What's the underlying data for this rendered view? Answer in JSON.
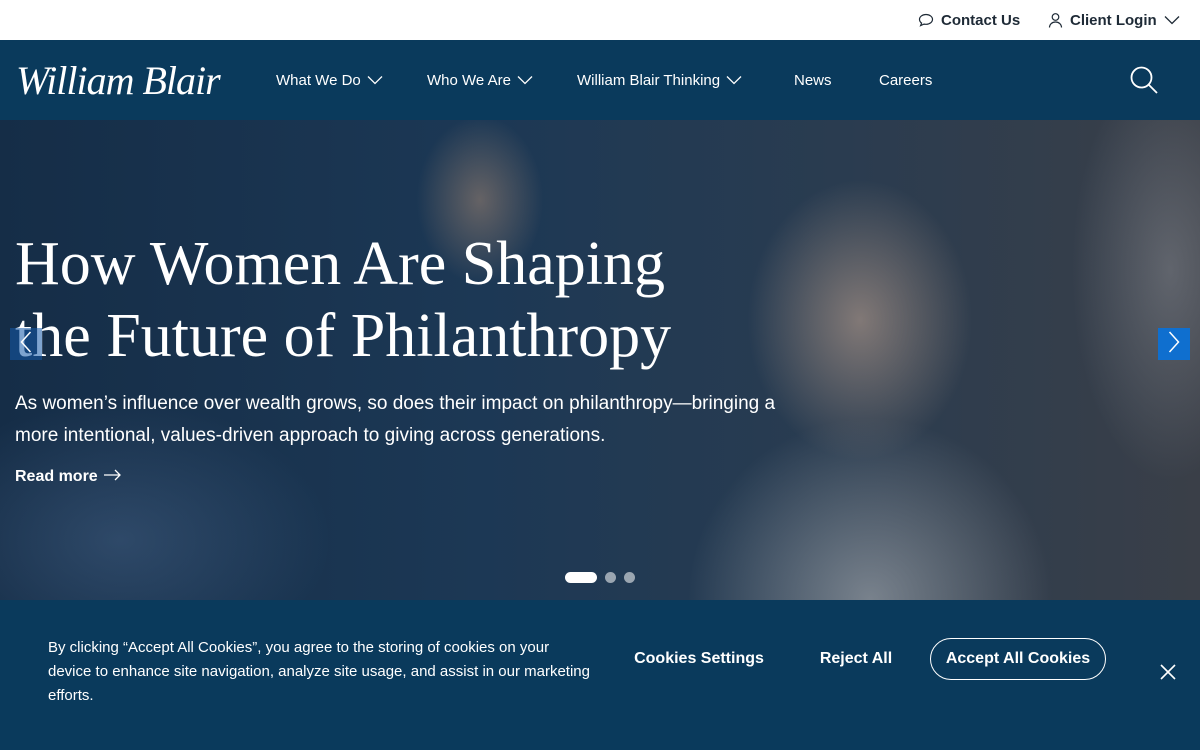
{
  "utility_bar": {
    "contact_label": "Contact Us",
    "contact_icon": "chat-bubble-icon",
    "login_label": "Client Login",
    "login_icon": "user-icon"
  },
  "nav": {
    "logo_text": "William Blair",
    "items": [
      {
        "label": "What We Do",
        "has_dropdown": true
      },
      {
        "label": "Who We Are",
        "has_dropdown": true
      },
      {
        "label": "William Blair Thinking",
        "has_dropdown": true
      },
      {
        "label": "News",
        "has_dropdown": false
      },
      {
        "label": "Careers",
        "has_dropdown": false
      }
    ],
    "search_icon": "search-icon"
  },
  "hero": {
    "title_line1": "How Women Are Shaping",
    "title_line2": "the Future of Philanthropy",
    "description": "As women’s influence over wealth grows, so does their impact on philanthropy—bringing a more intentional, values-driven approach to giving across generations.",
    "read_more": "Read more",
    "slide_count": 3,
    "active_slide": 1
  },
  "cookie_banner": {
    "text": "By clicking “Accept All Cookies”, you agree to the storing of cookies on your device to enhance site navigation, analyze site usage, and assist in our marketing efforts.",
    "settings_label": "Cookies Settings",
    "reject_label": "Reject All",
    "accept_label": "Accept All Cookies"
  },
  "colors": {
    "nav_bg": "#0a3a5c",
    "accent_blue": "#0f6fcf",
    "text_dark": "#1e2a36"
  }
}
